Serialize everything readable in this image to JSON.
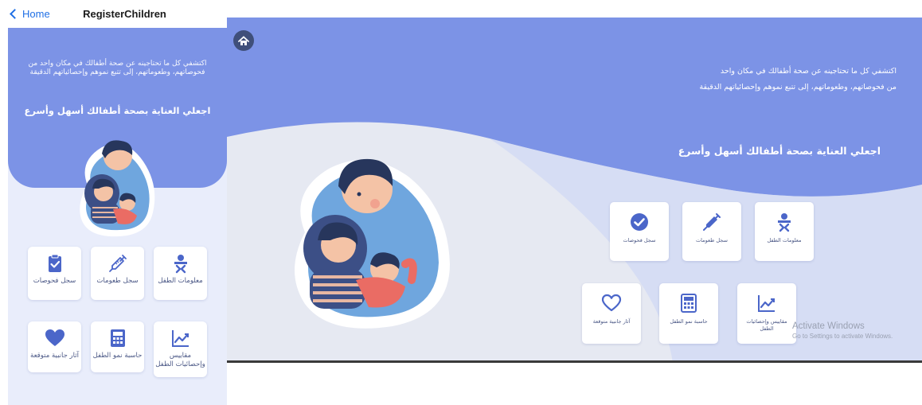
{
  "phone": {
    "nav": {
      "back_label": "Home",
      "title": "RegisterChildren"
    },
    "tagline": "اكتشفي كل ما تحتاجينه عن صحة أطفالك في مكان واحد من فحوصاتهم، وطعوماتهم، إلى تتبع نموهم وإحصائياتهم الدقيقة",
    "headline": "اجعلي العناية بصحة أطفالك أسهل وأسرع",
    "tiles": [
      {
        "label": "معلومات الطفل",
        "icon": "baby-icon"
      },
      {
        "label": "سجل طعومات",
        "icon": "syringe-icon"
      },
      {
        "label": "سجل فحوصات",
        "icon": "clipboard-check-icon"
      },
      {
        "label": "مقاييس وإحصائيات الطفل",
        "icon": "chart-line-icon"
      },
      {
        "label": "حاسبة نمو الطفل",
        "icon": "calculator-icon"
      },
      {
        "label": "آثار جانبية متوقعة",
        "icon": "heart-icon"
      }
    ]
  },
  "desktop": {
    "home_button": "home-icon",
    "tagline_line1": "اكتشفي كل ما تحتاجينه عن صحة أطفالك في مكان واحد",
    "tagline_line2": "من فحوصاتهم، وطعوماتهم، إلى تتبع نموهم وإحصائياتهم الدقيقة",
    "headline": "اجعلي العناية بصحة أطفالك أسهل وأسرع",
    "tiles": [
      {
        "label": "معلومات الطفل",
        "icon": "baby-icon"
      },
      {
        "label": "سجل طعومات",
        "icon": "syringe-icon"
      },
      {
        "label": "سجل فحوصات",
        "icon": "check-circle-icon"
      },
      {
        "label": "مقاييس وإحصائيات الطفل",
        "icon": "chart-line-icon"
      },
      {
        "label": "حاسبة نمو الطفل",
        "icon": "calculator-icon"
      },
      {
        "label": "آثار جانبية متوقعة",
        "icon": "heart-outline-icon"
      }
    ],
    "watermark_title": "Activate Windows",
    "watermark_sub": "Go to Settings to activate Windows."
  },
  "colors": {
    "hero_blue": "#7c93e6",
    "icon_blue": "#4b66c9",
    "background_light": "#e9edfb"
  }
}
